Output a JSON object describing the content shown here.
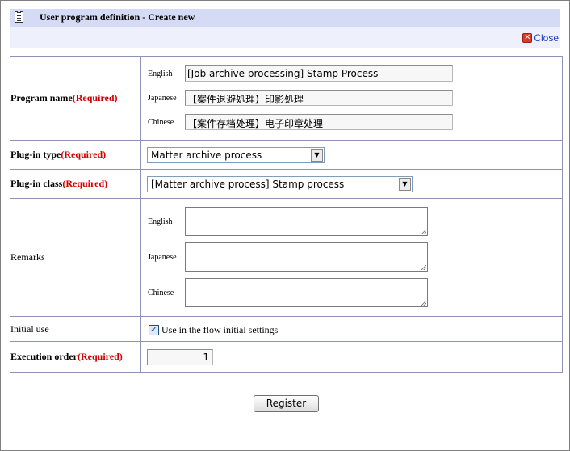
{
  "window": {
    "title": "User program definition - Create new",
    "close_label": "Close"
  },
  "form": {
    "program_name": {
      "label": "Program name",
      "required": "(Required)",
      "langs": [
        {
          "label": "English",
          "value": "[Job archive processing] Stamp Process"
        },
        {
          "label": "Japanese",
          "value": "【案件退避処理】印影処理"
        },
        {
          "label": "Chinese",
          "value": "【案件存档处理】电子印章处理"
        }
      ]
    },
    "plugin_type": {
      "label": "Plug-in type",
      "required": "(Required)",
      "selected": "Matter archive process"
    },
    "plugin_class": {
      "label": "Plug-in class",
      "required": "(Required)",
      "selected": "[Matter archive process] Stamp process"
    },
    "remarks": {
      "label": "Remarks",
      "langs": [
        {
          "label": "English",
          "value": ""
        },
        {
          "label": "Japanese",
          "value": ""
        },
        {
          "label": "Chinese",
          "value": ""
        }
      ]
    },
    "initial_use": {
      "label": "Initial use",
      "checkbox_label": "Use in the flow initial settings",
      "checked": true,
      "check_glyph": "✓"
    },
    "execution_order": {
      "label": "Execution order",
      "required": "(Required)",
      "value": "1"
    }
  },
  "actions": {
    "register_label": "Register"
  },
  "icons": {
    "title": "clipboard-icon",
    "close": "close-x-icon",
    "close_glyph": "✕",
    "dropdown_glyph": "▼"
  },
  "colors": {
    "titlebar": "#d6dbf5",
    "required": "#d00000",
    "link": "#1d3fb8",
    "border": "#8c93b5"
  }
}
